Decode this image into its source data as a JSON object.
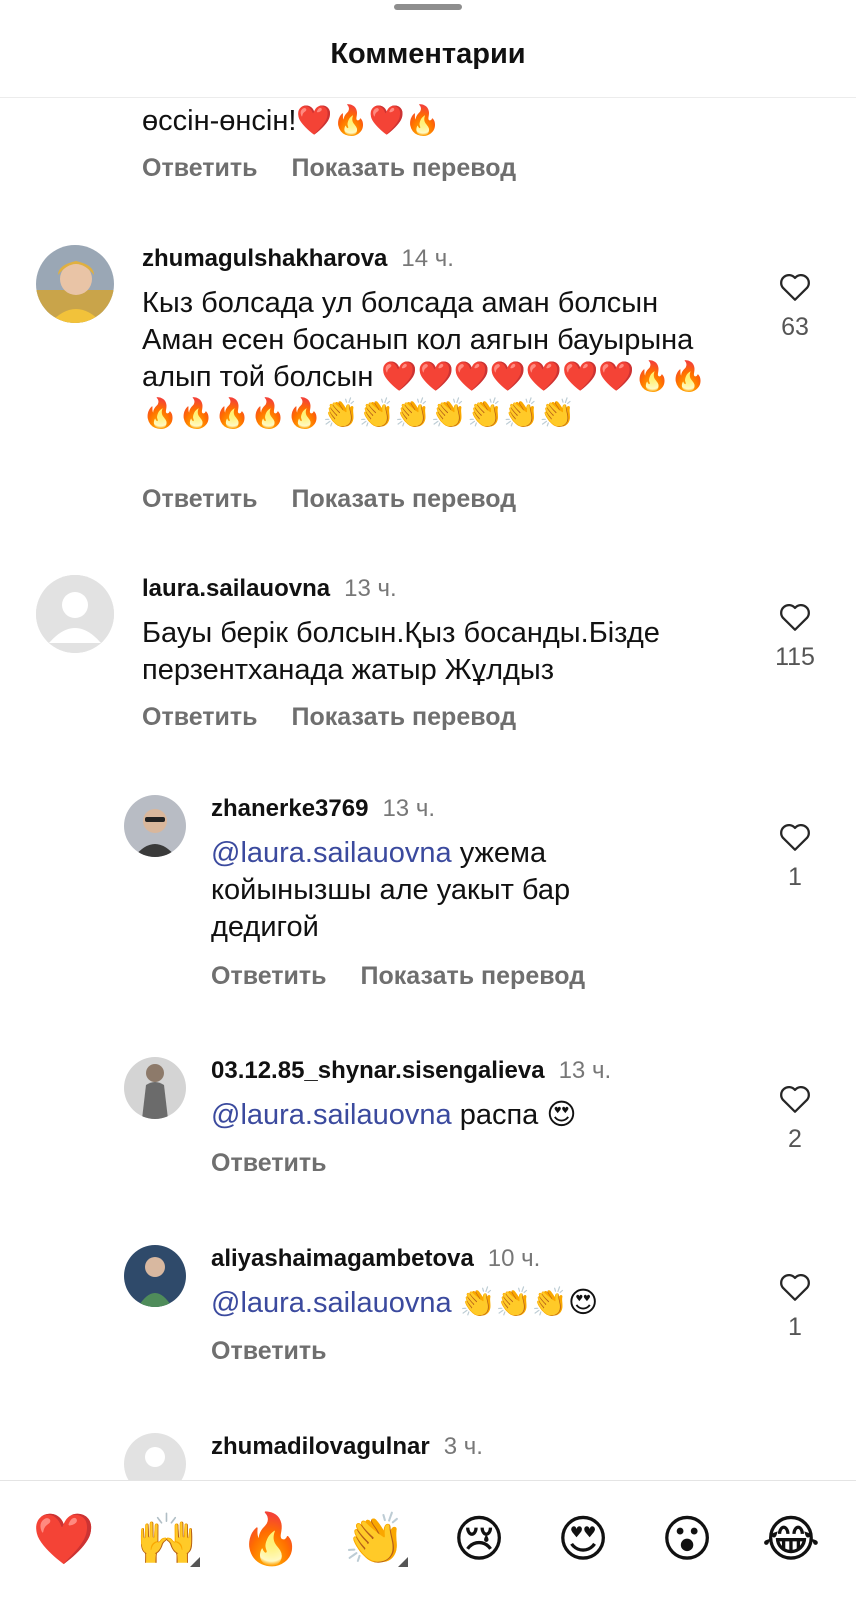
{
  "header": {
    "title": "Комментарии"
  },
  "top_partial": {
    "text": "өссін-өнсін!❤️🔥❤️🔥",
    "reply": "Ответить",
    "translate": "Показать перевод"
  },
  "comments": [
    {
      "username": "zhumagulshakharova",
      "time": "14 ч.",
      "text": "Кыз болсада ул болсада аман болсын Аман есен босанып кол аягын бауырына алып той болсын ❤️❤️❤️❤️❤️❤️❤️🔥🔥🔥🔥🔥🔥🔥👏👏👏👏👏👏👏",
      "likes": "63",
      "reply": "Ответить",
      "translate": "Показать перевод"
    },
    {
      "username": "laura.sailauovna",
      "time": "13 ч.",
      "text": "Бауы берік болсын.Қыз босанды.Бізде перзентханада жатыр Жұлдыз",
      "likes": "115",
      "reply": "Ответить",
      "translate": "Показать перевод"
    }
  ],
  "replies": [
    {
      "username": "zhanerke3769",
      "time": "13 ч.",
      "mention": "@laura.sailauovna",
      "text": " ужема койынызшы але уакыт бар дедигой",
      "likes": "1",
      "reply": "Ответить",
      "translate": "Показать перевод"
    },
    {
      "username": "03.12.85_shynar.sisengalieva",
      "time": "13 ч.",
      "mention": "@laura.sailauovna",
      "text": " распа 😍",
      "likes": "2",
      "reply": "Ответить"
    },
    {
      "username": "aliyashaimagambetova",
      "time": "10 ч.",
      "mention": "@laura.sailauovna",
      "text": " 👏👏👏😍",
      "likes": "1",
      "reply": "Ответить"
    },
    {
      "username": "zhumadilovagulnar",
      "time": "3 ч."
    }
  ],
  "emoji_bar": [
    "❤️",
    "🙌",
    "🔥",
    "👏",
    "😢",
    "😍",
    "😮",
    "😂"
  ]
}
